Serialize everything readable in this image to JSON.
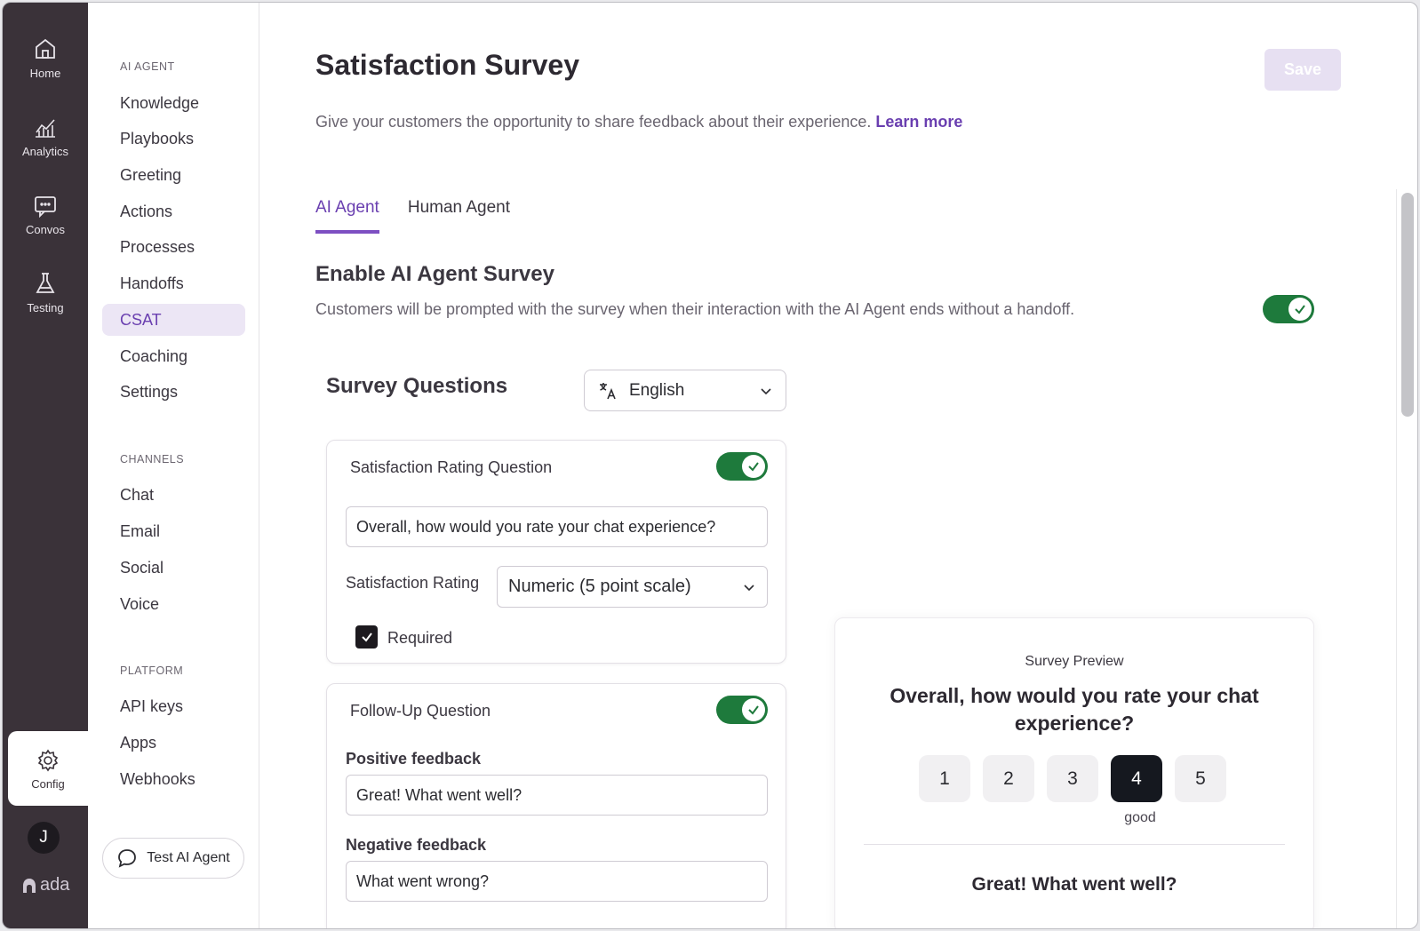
{
  "rail": {
    "home": "Home",
    "analytics": "Analytics",
    "convos": "Convos",
    "testing": "Testing",
    "config": "Config",
    "avatar_initial": "J",
    "logo": "ada"
  },
  "sidebar": {
    "ai_agent_label": "AI AGENT",
    "ai_agent_items": [
      "Knowledge",
      "Playbooks",
      "Greeting",
      "Actions",
      "Processes",
      "Handoffs",
      "CSAT",
      "Coaching",
      "Settings"
    ],
    "channels_label": "CHANNELS",
    "channel_items": [
      "Chat",
      "Email",
      "Social",
      "Voice"
    ],
    "platform_label": "PLATFORM",
    "platform_items": [
      "API keys",
      "Apps",
      "Webhooks"
    ],
    "test_button": "Test AI Agent",
    "active_item": "CSAT"
  },
  "header": {
    "title": "Satisfaction Survey",
    "save_label": "Save",
    "subtitle": "Give your customers the opportunity to share feedback about their experience.",
    "learn_more": "Learn more"
  },
  "tabs": [
    {
      "label": "AI Agent",
      "active": true
    },
    {
      "label": "Human Agent",
      "active": false
    }
  ],
  "enable": {
    "title": "Enable AI Agent Survey",
    "description": "Customers will be prompted with the survey when their interaction with the AI Agent ends without a handoff.",
    "enabled": true
  },
  "survey": {
    "title": "Survey Questions",
    "language": "English",
    "rating_card": {
      "title": "Satisfaction Rating Question",
      "enabled": true,
      "question": "Overall, how would you rate your chat experience?",
      "rating_label": "Satisfaction Rating",
      "rating_type": "Numeric (5 point scale)",
      "required_label": "Required",
      "required": true
    },
    "followup_card": {
      "title": "Follow-Up Question",
      "enabled": true,
      "positive_label": "Positive feedback",
      "positive_value": "Great! What went well?",
      "negative_label": "Negative feedback",
      "negative_value": "What went wrong?"
    }
  },
  "preview": {
    "label": "Survey Preview",
    "question": "Overall, how would you rate your chat experience?",
    "ratings": [
      "1",
      "2",
      "3",
      "4",
      "5"
    ],
    "selected": "4",
    "selected_caption": "good",
    "followup": "Great! What went well?"
  },
  "colors": {
    "rail_bg": "#3a3239",
    "accent": "#6a3fb0",
    "toggle_on": "#1e7a3c",
    "selected_rating": "#15181f"
  }
}
